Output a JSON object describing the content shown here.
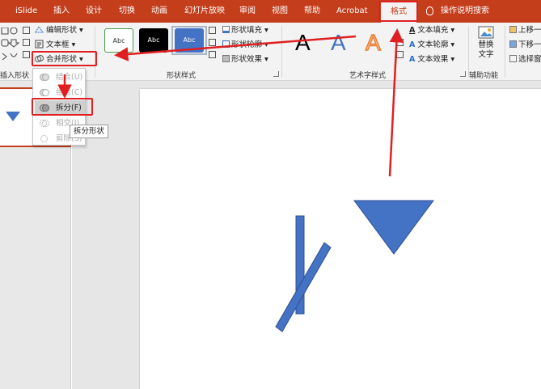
{
  "tabs": [
    {
      "label": "iSlide"
    },
    {
      "label": "插入"
    },
    {
      "label": "设计"
    },
    {
      "label": "切换"
    },
    {
      "label": "动画"
    },
    {
      "label": "幻灯片放映"
    },
    {
      "label": "审阅"
    },
    {
      "label": "视图"
    },
    {
      "label": "帮助"
    },
    {
      "label": "Acrobat"
    },
    {
      "label": "格式",
      "active": true
    }
  ],
  "tell_me": "操作说明搜索",
  "ribbon": {
    "insert_shapes": {
      "edit_shape": "编辑形状",
      "text_box": "文本框",
      "merge_shapes": "合并形状",
      "group_label": "插入形状"
    },
    "shape_styles": {
      "swatches": [
        "Abc",
        "Abc",
        "Abc"
      ],
      "shape_fill": "形状填充",
      "shape_outline": "形状轮廓",
      "shape_effects": "形状效果",
      "group_label": "形状样式"
    },
    "wordart_styles": {
      "letters": [
        "A",
        "A",
        "A"
      ],
      "text_fill": "文本填充",
      "text_outline": "文本轮廓",
      "text_effects": "文本效果",
      "group_label": "艺术字样式"
    },
    "accessibility": {
      "alt_text_line1": "替换",
      "alt_text_line2": "文字",
      "group_label": "辅助功能"
    },
    "arrange": {
      "bring_forward": "上移一",
      "send_backward": "下移一",
      "selection_pane": "选择窗"
    }
  },
  "merge_menu": {
    "items": [
      {
        "label": "结合(U)",
        "enabled": false
      },
      {
        "label": "组合(C)",
        "enabled": false
      },
      {
        "label": "拆分(F)",
        "enabled": true
      },
      {
        "label": "相交(I)",
        "enabled": false
      },
      {
        "label": "剪除(S)",
        "enabled": false
      }
    ],
    "tooltip": "拆分形状"
  },
  "colors": {
    "accent": "#c43e1c",
    "shape_fill": "#4472c4",
    "annotation": "#e02020"
  }
}
